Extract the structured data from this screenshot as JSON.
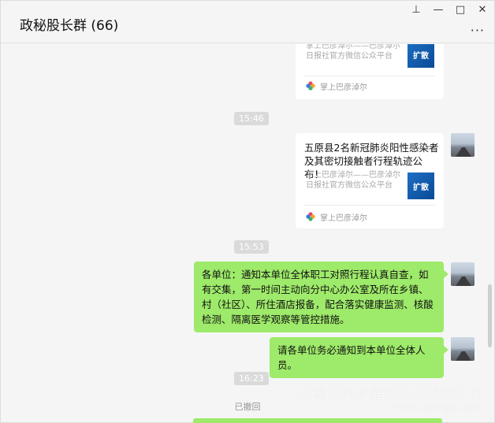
{
  "header": {
    "title": "政秘股长群 (66)",
    "more_label": "···",
    "controls": {
      "pin": "⊥",
      "minimize": "—",
      "maximize": "□",
      "close": "✕"
    }
  },
  "messages": {
    "card_top": {
      "desc": "掌上巴彦淖尔——巴彦淖尔日报社官方微信公众平台",
      "thumb_label": "扩散",
      "source_name": "掌上巴彦淖尔"
    },
    "time_1": "15:46",
    "card_main": {
      "title": "五原县2名新冠肺炎阳性感染者及其密切接触者行程轨迹公布！",
      "desc": "掌上巴彦淖尔——巴彦淖尔日报社官方微信公众平台",
      "thumb_label": "扩散",
      "source_name": "掌上巴彦淖尔"
    },
    "time_2": "15:53",
    "text_1": "各单位：通知本单位全体职工对照行程认真自查，如有交集，第一时间主动向分中心办公室及所在乡镇、村（社区）、所住酒店报备，配合落实健康监测、核酸检测、隔离医学观察等管控措施。",
    "text_2": "请各单位务必通知到本单位全体人员。",
    "time_3": "16:23",
    "recalled": "已撤回"
  },
  "watermark": {
    "line1": "内蒙古河套灌区水利发展中心",
    "line2": "www.zghtgq.com"
  },
  "colors": {
    "bubble": "#9eea6a",
    "time_bg": "#dadada",
    "thumb": "#1e6fc4"
  },
  "icons": {
    "pin": "pin-icon",
    "source_logo": "flower-logo-icon"
  }
}
